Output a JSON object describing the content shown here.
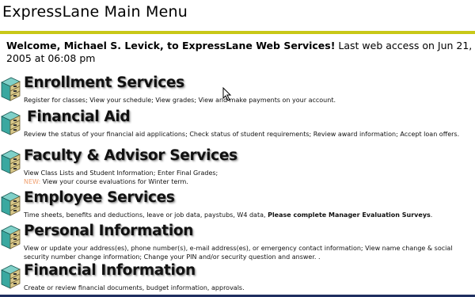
{
  "page": {
    "title": "ExpressLane Main Menu",
    "welcome_bold": "Welcome, Michael S. Levick, to ExpressLane Web Services!",
    "welcome_rest": " Last web access on Jun 21, 2005 at 06:08 pm"
  },
  "colors": {
    "title_rule": "#c8c818",
    "bottom_rule": "#1f2f60",
    "new_tag": "#f0a070",
    "icon_teal": "#3aa8a0"
  },
  "sections": [
    {
      "heading": "Enrollment Services",
      "icon": "cabinet-icon",
      "desc": "Register for classes; View your schedule; View grades; View and make payments on your account."
    },
    {
      "heading": "Financial Aid",
      "icon": "cabinet-icon",
      "desc": "Review the status of your financial aid applications; Check status of student requirements; Review award information; Accept loan offers."
    },
    {
      "heading": "Faculty & Advisor Services",
      "icon": "cabinet-icon",
      "desc": "View Class Lists and Student Information; Enter Final Grades;",
      "new_label": "NEW:",
      "desc2": " View your course evaluations for Winter term."
    },
    {
      "heading": "Employee Services",
      "icon": "cabinet-icon",
      "desc": "Time sheets, benefits and deductions, leave or job data, paystubs, W4 data, ",
      "desc_bold": "Please complete Manager Evaluation Surveys",
      "desc_end": "."
    },
    {
      "heading": "Personal Information",
      "icon": "cabinet-icon",
      "desc": "View or update your address(es), phone number(s), e-mail address(es), or emergency contact information; View name change & social security number change information; Change your PIN and/or security question and answer. ."
    },
    {
      "heading": "Financial Information",
      "icon": "cabinet-icon",
      "desc": "Create or review financial documents, budget information, approvals."
    }
  ]
}
